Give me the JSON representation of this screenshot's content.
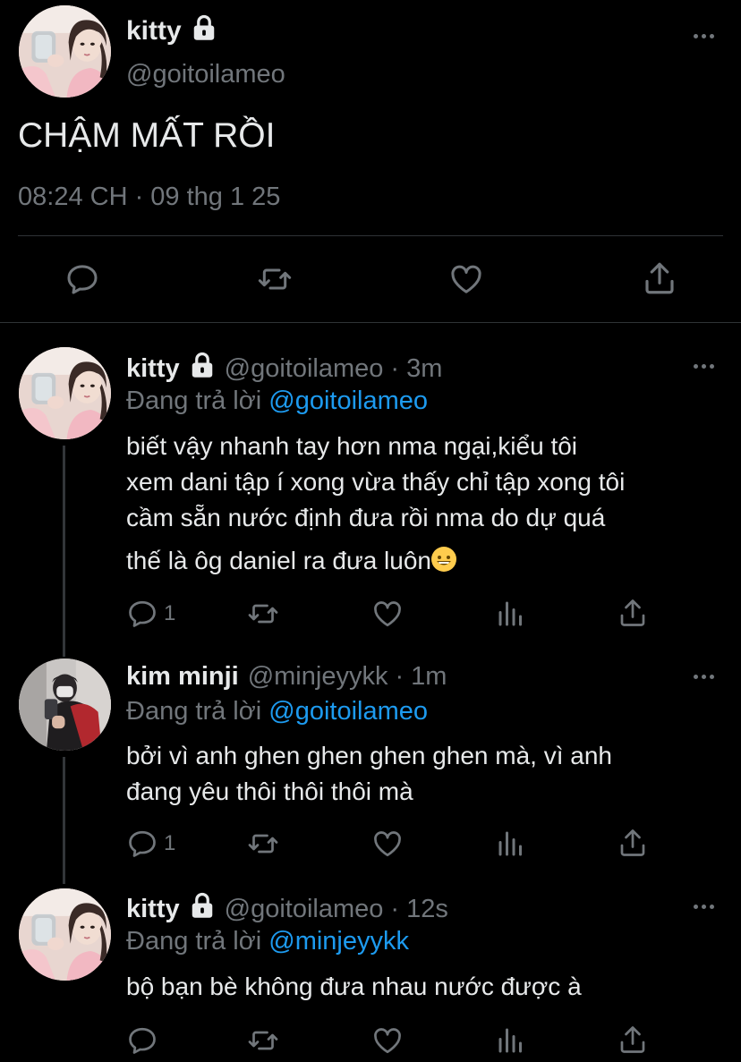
{
  "main": {
    "author_name": "kitty",
    "author_handle": "@goitoilameo",
    "text": "CHẬM MẤT RỒI",
    "timestamp": "08:24 CH · 09 thg 1 25"
  },
  "replies": [
    {
      "name": "kitty",
      "handle": "@goitoilameo",
      "time": "· 3m",
      "replying_prefix": "Đang trả lời",
      "replying_to": "@goitoilameo",
      "lines": [
        "biết vậy nhanh tay hơn nma ngại,kiểu tôi",
        "xem dani tập í xong vừa thấy chỉ tập xong tôi",
        "cầm sẵn nước định đưa rồi nma do dự quá",
        "thế là ôg daniel ra đưa luôn"
      ],
      "reply_count": "1"
    },
    {
      "name": "kim minji",
      "handle": "@minjeyykk",
      "time": "· 1m",
      "replying_prefix": "Đang trả lời",
      "replying_to": "@goitoilameo",
      "lines": [
        "bởi vì anh ghen ghen ghen ghen mà, vì anh",
        "đang yêu thôi thôi thôi  mà"
      ],
      "reply_count": "1"
    },
    {
      "name": "kitty",
      "handle": "@goitoilameo",
      "time": "· 12s",
      "replying_prefix": "Đang trả lời",
      "replying_to": "@minjeyykk",
      "lines": [
        "bộ bạn bè không đưa nhau nước được à"
      ],
      "reply_count": ""
    }
  ],
  "icons": {
    "reply": "reply-icon",
    "retweet": "retweet-icon",
    "like": "heart-icon",
    "views": "views-icon",
    "share": "share-icon",
    "lock": "lock-icon",
    "more": "more-icon"
  },
  "colors": {
    "background": "#000000",
    "text": "#e7e9ea",
    "muted": "#71767b",
    "link": "#1d9bf0",
    "divider": "#2f3336"
  }
}
